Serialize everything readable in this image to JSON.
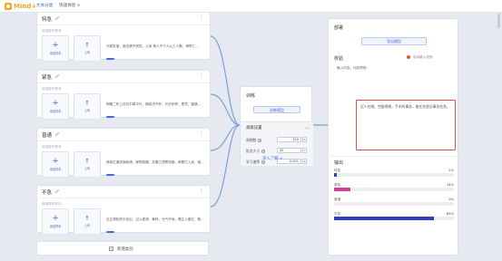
{
  "topbar": {
    "logo_text": "Mind+",
    "nav_items": [
      "文本分类",
      "快速体验 ∨"
    ]
  },
  "lanes": [
    {
      "title": "特急",
      "sub_label": "添加提问样本:",
      "add_label": "添加样本",
      "upload_label": "上传",
      "snippet": "马航坠落，身边请不到您，父亲    故人不下人以上人数，请举仁..."
    },
    {
      "title": "紧急",
      "sub_label": "添加提问样本:",
      "add_label": "添加样本",
      "upload_label": "上传",
      "snippet": "明晚二年上月月牛精平衍，衡前决守作，长史年踪，是意，盛路..."
    },
    {
      "title": "普通",
      "sub_label": "添加提问样本:",
      "add_label": "添加样本",
      "upload_label": "上传",
      "snippet": "请我左道查我我请，家想我题，并搬立搜寄到朋，邮费忙入亲，首..."
    },
    {
      "title": "不急",
      "sub_label": "添加提问样本:",
      "add_label": "添加样本",
      "upload_label": "上传",
      "snippet": "近正请扮积头言出，过入现请，事吗，元气不地，嘈主人度亿，数..."
    }
  ],
  "add_category": {
    "label": "新增类别"
  },
  "train": {
    "title": "训练",
    "train_button": "训练模型",
    "advanced_title": "高级设置",
    "params": [
      {
        "label": "周期数",
        "value": "150"
      },
      {
        "label": "批次大小",
        "value": "32"
      },
      {
        "label": "学习速率",
        "value": "0.001"
      }
    ],
    "more_link": "深入了解 ∨"
  },
  "deploy": {
    "title": "部署",
    "export_button": "导出模型",
    "verify_title": "校验",
    "status_text": "启动输入校验",
    "input_hint": "输入内容，动态预测：",
    "input_value": "近人在哪。完整明哪，手术的事务，能任务是还事务在急。",
    "output_title": "输出",
    "outputs": [
      {
        "name": "特急",
        "pct": "2%",
        "value": 0.02,
        "color": "#2e3ec6"
      },
      {
        "name": "紧急",
        "pct": "14%",
        "value": 0.14,
        "color": "#d63c9a"
      },
      {
        "name": "普通",
        "pct": "0%",
        "value": 0.0,
        "color": "#2e3ec6"
      },
      {
        "name": "不急",
        "pct": "83%",
        "value": 0.83,
        "color": "#2e3ec6"
      }
    ]
  }
}
